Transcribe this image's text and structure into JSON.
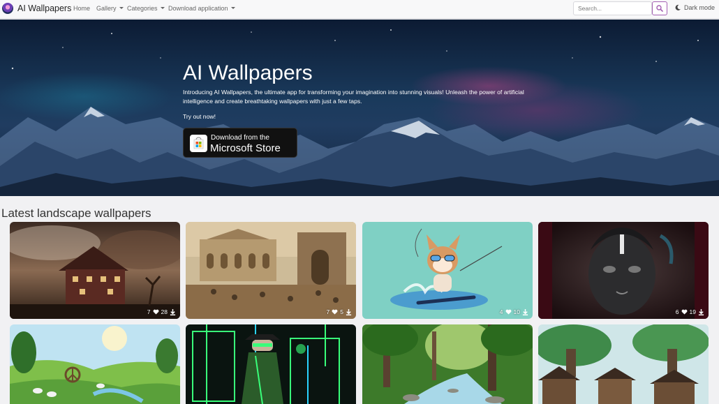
{
  "brand": {
    "name": "AI Wallpapers"
  },
  "nav": {
    "home": "Home",
    "gallery": "Gallery",
    "categories": "Categories",
    "download": "Download application"
  },
  "search": {
    "placeholder": "Search..."
  },
  "dark_mode": "Dark mode",
  "hero": {
    "title": "AI Wallpapers",
    "description": "Introducing AI Wallpapers, the ultimate app for transforming your imagination into stunning visuals! Unleash the power of artificial intelligence and create breathtaking wallpapers with just a few taps.",
    "try": "Try out now!",
    "store_small": "Download from the",
    "store_big": "Microsoft Store"
  },
  "section": {
    "title": "Latest landscape wallpapers"
  },
  "wallpapers": [
    {
      "likes": "7",
      "downloads": "28"
    },
    {
      "likes": "7",
      "downloads": "5"
    },
    {
      "likes": "4",
      "downloads": "10"
    },
    {
      "likes": "6",
      "downloads": "19"
    }
  ],
  "icons": {
    "logo": "ai-wallpapers-logo",
    "search": "search-icon",
    "moon": "moon-icon",
    "heart": "heart-icon",
    "download": "download-icon",
    "store": "microsoft-store-icon"
  },
  "colors": {
    "accent": "#a35fb2",
    "navbar_bg": "#f8f8f9",
    "page_bg": "#f1f1f3"
  }
}
